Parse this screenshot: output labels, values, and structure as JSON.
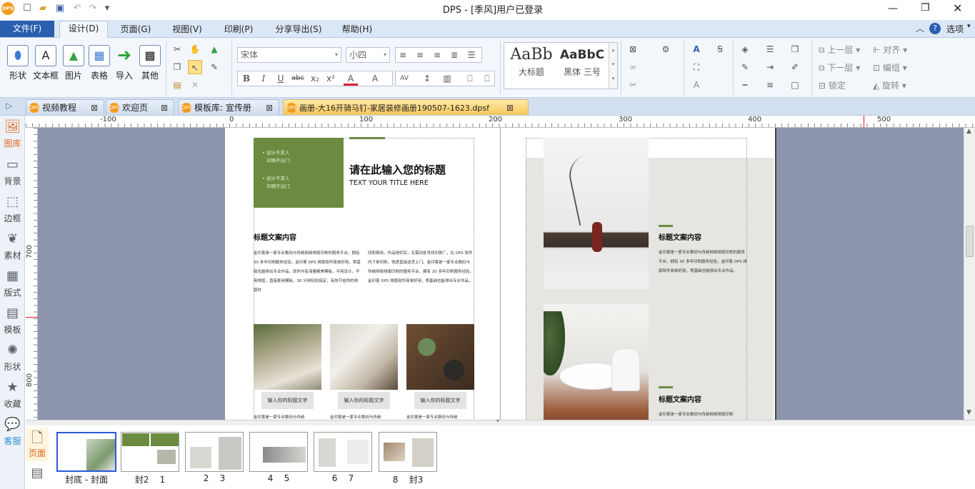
{
  "window": {
    "title": "DPS - [季风]用户已登录"
  },
  "menu": {
    "file": "文件(F)",
    "items": [
      "设计(D)",
      "页面(G)",
      "视图(V)",
      "印刷(P)",
      "分享导出(S)",
      "帮助(H)"
    ],
    "options": "选项"
  },
  "ribbon": {
    "big_buttons": [
      "形状",
      "文本框",
      "图片",
      "表格",
      "导入",
      "其他"
    ],
    "font_name": "宋体",
    "font_size": "小四",
    "styles": [
      {
        "sample": "AaBb",
        "label": "大标题"
      },
      {
        "sample": "AaBbC",
        "label": "黑体  三号"
      }
    ],
    "arrange": [
      "上一层",
      "对齐",
      "下一层",
      "编组",
      "锁定",
      "旋转"
    ]
  },
  "doc_tabs": [
    {
      "label": "视频教程",
      "active": false
    },
    {
      "label": "欢迎页",
      "active": false
    },
    {
      "label": "模板库: 宣传册",
      "active": false
    },
    {
      "label": "画册-大16开骑马钉-家居装修画册190507-1623.dpsf",
      "active": true
    }
  ],
  "left_panel": [
    "图库",
    "背景",
    "边框",
    "素材",
    "版式",
    "模板",
    "形状",
    "收藏",
    "客服"
  ],
  "ruler": {
    "top": [
      "-100",
      "0",
      "100",
      "200",
      "300",
      "400",
      "500"
    ],
    "left": [
      "700",
      "800"
    ]
  },
  "page_left": {
    "green_box_lines": [
      "设计不求人",
      "印刷不出门",
      "设计不求人",
      "印刷不出门"
    ],
    "title": "请在此输入您的标题",
    "subtitle": "TEXT YOUR TITLE HERE",
    "section_title": "标题文案内容",
    "col1": "金印客是一家专业数码与传统网络排版印刷的服务平台，拥有 30 多年印刷服务经验，金印客 DPS 排版软件简单好用，零基础也能排出专业作品，软件内有海量精美模板，不用设计，不用排版，直接套用模板，30 分钟轻松搞定，有效节省你的排版时",
    "col2": "间和费用，作品排好后，无需到处寻找印刷厂，在 DPS 软件内下单印刷，快递直接送货上门。金印客是一家专业数码与传统网络排版印刷的服务平台，拥有 30 多年印刷服务经验，金印客 DPS 排版软件简单好用，零基础也能排出专业作品。",
    "captions": [
      "输入你的标题文字",
      "输入你的标题文字",
      "输入你的标题文字"
    ],
    "bottom_text": "金印客是一家专业数码与传统"
  },
  "page_right": {
    "section1_title": "标题文案内容",
    "section1_body": "金印客是一家专业数码与传统网络排版印刷的服务平台，拥有 30 多年印刷服务经验，金印客 DPS 排版软件简单好用，零基础也能排出专业作品。",
    "section2_title": "标题文案内容",
    "section2_body": "金印客是一家专业数码与传统网络排版印刷"
  },
  "page_strip": {
    "page_btn": "页面",
    "thumbs": [
      {
        "label": "封底 - 封面",
        "selected": true
      },
      {
        "label": "封2    1",
        "selected": false
      },
      {
        "label": "2    3",
        "selected": false
      },
      {
        "label": "4    5",
        "selected": false
      },
      {
        "label": "6    7",
        "selected": false
      },
      {
        "label": "8    封3",
        "selected": false
      }
    ]
  }
}
